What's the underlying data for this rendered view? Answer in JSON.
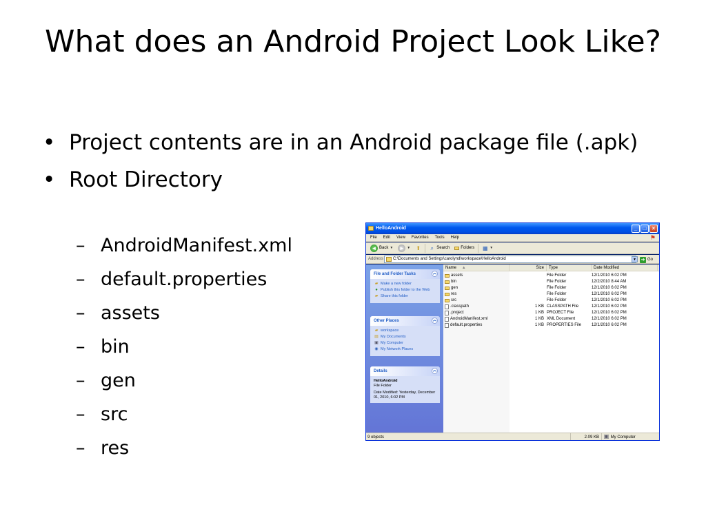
{
  "slide": {
    "title": "What does an Android Project Look Like?",
    "bullets": [
      "Project contents are in an Android package file (.apk)",
      "Root Directory"
    ],
    "bullet_symbol": "•",
    "sub_dash": "–",
    "sub_items": [
      "AndroidManifest.xml",
      "default.properties",
      "assets",
      "bin",
      "gen",
      "src",
      "res"
    ]
  },
  "explorer": {
    "title": "HelloAndroid",
    "menu": [
      "File",
      "Edit",
      "View",
      "Favorites",
      "Tools",
      "Help"
    ],
    "toolbar": {
      "back": "Back",
      "search": "Search",
      "folders": "Folders"
    },
    "address": {
      "label": "Address",
      "path": "C:\\Documents and Settings\\carolynd\\workspace\\HelloAndroid",
      "go": "Go"
    },
    "file_tasks": {
      "heading": "File and Folder Tasks",
      "links": [
        "Make a new folder",
        "Publish this folder to the Web",
        "Share this folder"
      ]
    },
    "other_places": {
      "heading": "Other Places",
      "links": [
        "workspace",
        "My Documents",
        "My Computer",
        "My Network Places"
      ]
    },
    "details": {
      "heading": "Details",
      "name": "HelloAndroid",
      "type": "File Folder",
      "modified": "Date Modified: Yesterday, December 01, 2010, 6:02 PM"
    },
    "columns": {
      "name": "Name",
      "size": "Size",
      "type": "Type",
      "date": "Date Modified"
    },
    "files": [
      {
        "name": "assets",
        "size": "",
        "type": "File Folder",
        "date": "12/1/2010 6:02 PM",
        "kind": "folder"
      },
      {
        "name": "bin",
        "size": "",
        "type": "File Folder",
        "date": "12/2/2010 8:44 AM",
        "kind": "folder"
      },
      {
        "name": "gen",
        "size": "",
        "type": "File Folder",
        "date": "12/1/2010 6:02 PM",
        "kind": "folder"
      },
      {
        "name": "res",
        "size": "",
        "type": "File Folder",
        "date": "12/1/2010 6:02 PM",
        "kind": "folder"
      },
      {
        "name": "src",
        "size": "",
        "type": "File Folder",
        "date": "12/1/2010 6:02 PM",
        "kind": "folder"
      },
      {
        "name": ".classpath",
        "size": "1 KB",
        "type": "CLASSPATH File",
        "date": "12/1/2010 6:02 PM",
        "kind": "file"
      },
      {
        "name": ".project",
        "size": "1 KB",
        "type": "PROJECT File",
        "date": "12/1/2010 6:02 PM",
        "kind": "file"
      },
      {
        "name": "AndroidManifest.xml",
        "size": "1 KB",
        "type": "XML Document",
        "date": "12/1/2010 6:02 PM",
        "kind": "file"
      },
      {
        "name": "default.properties",
        "size": "1 KB",
        "type": "PROPERTIES File",
        "date": "12/1/2010 6:02 PM",
        "kind": "file"
      }
    ],
    "status": {
      "objects": "9 objects",
      "size": "2.09 KB",
      "location": "My Computer"
    },
    "colors": {
      "titlebar": "#0058ee",
      "taskpane": "#6375d6",
      "link": "#215dc6"
    }
  }
}
